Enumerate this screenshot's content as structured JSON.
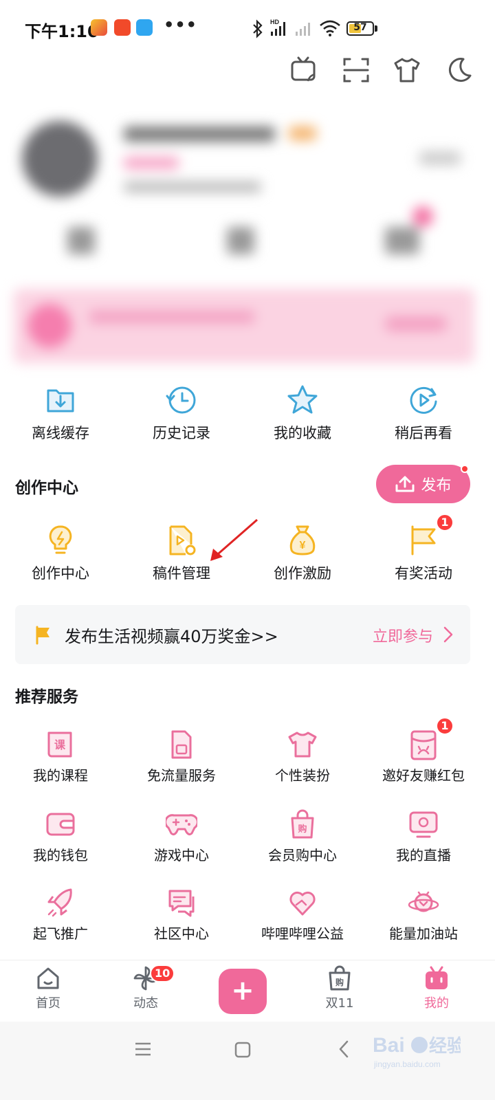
{
  "status_bar": {
    "time": "下午1:10",
    "battery": "57",
    "battery_level": 0.57,
    "icons": [
      "app-icon-panda",
      "app-icon-taobao",
      "app-icon-blue",
      "bluetooth-icon",
      "signal-icon",
      "wifi-icon",
      "battery-icon"
    ]
  },
  "top_icons": [
    "tv-icon",
    "scan-icon",
    "tshirt-icon",
    "moon-icon"
  ],
  "colors": {
    "accent": "#f0699a",
    "badge": "#fb3c3c",
    "teal": "#3fa6d8",
    "yellow": "#f5b422"
  },
  "quick_row": [
    {
      "label": "离线缓存",
      "icon": "download-folder-icon"
    },
    {
      "label": "历史记录",
      "icon": "history-clock-icon"
    },
    {
      "label": "我的收藏",
      "icon": "star-icon"
    },
    {
      "label": "稍后再看",
      "icon": "watch-later-icon"
    }
  ],
  "creation": {
    "title": "创作中心",
    "publish_label": "发布",
    "items": [
      {
        "label": "创作中心",
        "icon": "lightbulb-icon"
      },
      {
        "label": "稿件管理",
        "icon": "manuscript-icon"
      },
      {
        "label": "创作激励",
        "icon": "money-bag-icon"
      },
      {
        "label": "有奖活动",
        "icon": "flag-icon",
        "badge": "1"
      }
    ]
  },
  "banner": {
    "text": "发布生活视频赢40万奖金>>",
    "link": "立即参与"
  },
  "services": {
    "title": "推荐服务",
    "items": [
      {
        "label": "我的课程",
        "icon": "course-book-icon"
      },
      {
        "label": "免流量服务",
        "icon": "sim-card-icon"
      },
      {
        "label": "个性装扮",
        "icon": "tshirt-icon"
      },
      {
        "label": "邀好友赚红包",
        "icon": "red-packet-icon",
        "badge": "1"
      },
      {
        "label": "我的钱包",
        "icon": "wallet-icon"
      },
      {
        "label": "游戏中心",
        "icon": "gamepad-icon"
      },
      {
        "label": "会员购中心",
        "icon": "shopping-bag-icon"
      },
      {
        "label": "我的直播",
        "icon": "live-tv-icon"
      },
      {
        "label": "起飞推广",
        "icon": "rocket-icon"
      },
      {
        "label": "社区中心",
        "icon": "chat-bubbles-icon"
      },
      {
        "label": "哔哩哔哩公益",
        "icon": "heart-icon"
      },
      {
        "label": "能量加油站",
        "icon": "energy-planet-icon"
      }
    ]
  },
  "bottom_nav": {
    "items": [
      {
        "label": "首页",
        "icon": "home-icon"
      },
      {
        "label": "动态",
        "icon": "pinwheel-icon",
        "badge": "10"
      },
      {
        "label": "双11",
        "icon": "shopping-bag-icon"
      },
      {
        "label": "我的",
        "icon": "tv-mascot-icon"
      }
    ],
    "active": "我的"
  }
}
